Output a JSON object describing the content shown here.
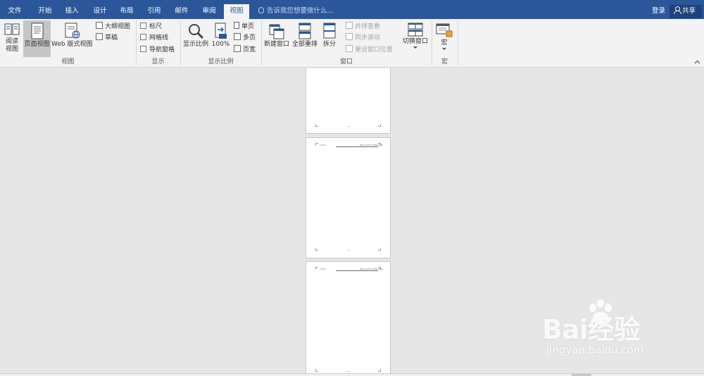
{
  "tabs": [
    {
      "label": "文件",
      "active": false
    },
    {
      "label": "开始",
      "active": false
    },
    {
      "label": "插入",
      "active": false
    },
    {
      "label": "设计",
      "active": false
    },
    {
      "label": "布局",
      "active": false
    },
    {
      "label": "引用",
      "active": false
    },
    {
      "label": "邮件",
      "active": false
    },
    {
      "label": "审阅",
      "active": false
    },
    {
      "label": "视图",
      "active": true
    }
  ],
  "tell_me": "告诉我您想要做什么...",
  "login": "登录",
  "share": "共享",
  "colors": {
    "tab_bar": "#2b579a",
    "ribbon": "#f3f3f3",
    "workspace": "#e6e6e6",
    "selected": "#c5c5c5"
  },
  "groups": {
    "views": {
      "label": "视图",
      "read_mode": "阅读\n视图",
      "print_layout": "页面视图",
      "web_layout": "Web 版式视图",
      "outline": "大纲视图",
      "draft": "草稿"
    },
    "show": {
      "label": "显示",
      "ruler": "标尺",
      "gridlines": "网格线",
      "nav_pane": "导航窗格"
    },
    "zoom": {
      "label": "显示比例",
      "zoom": "显示比例",
      "hundred": "100%",
      "one_page": "单页",
      "multi_page": "多页",
      "page_width": "页宽"
    },
    "window": {
      "label": "窗口",
      "new_window": "新建窗口",
      "arrange_all": "全部重排",
      "split": "拆分",
      "side_by_side": "并排查看",
      "sync_scroll": "同步滚动",
      "reset_pos": "重设窗口位置",
      "switch_windows": "切换窗口"
    },
    "macros": {
      "label": "宏",
      "macros": "宏"
    }
  },
  "page_header": {
    "logo_text": "LOGO",
    "right_text": "Microsoft Confidential"
  },
  "watermark": {
    "brand": "Bai经验",
    "url": "jingyan.baidu.com"
  }
}
